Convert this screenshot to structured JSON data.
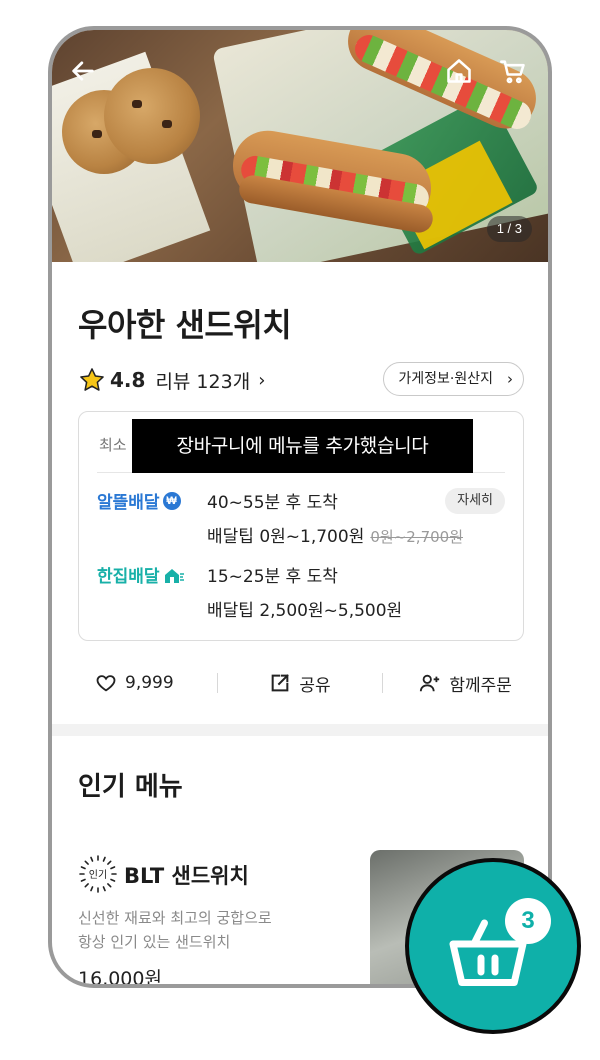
{
  "hero": {
    "image_counter": "1 / 3",
    "icons": {
      "back": "back-arrow-icon",
      "home": "home-icon",
      "cart": "cart-icon"
    }
  },
  "store": {
    "name": "우아한 샌드위치",
    "rating": "4.8",
    "review_text": "리뷰 123개",
    "info_button": "가게정보·원산지"
  },
  "delivery": {
    "min_order_label": "최소",
    "options": [
      {
        "label": "알뜰배달",
        "time": "40~55분 후 도착",
        "tip": "배달팁 0원~1,700원",
        "original_tip": "0원~2,700원",
        "detail_button": "자세히"
      },
      {
        "label": "한집배달",
        "time": "15~25분 후 도착",
        "tip": "배달팁 2,500원~5,500원"
      }
    ]
  },
  "toast": "장바구니에 메뉴를 추가했습니다",
  "actions": {
    "like_count": "9,999",
    "share_label": "공유",
    "group_order_label": "함께주문"
  },
  "section": {
    "title": "인기 메뉴"
  },
  "menu_items": [
    {
      "badge": "인기",
      "name": "BLT 샌드위치",
      "desc_line1": "신선한 재료와 최고의 궁합으로",
      "desc_line2": "항상 인기 있는 샌드위치",
      "price": "16,000원"
    }
  ],
  "cart": {
    "count": "3"
  },
  "colors": {
    "accent_teal": "#0fb0a9",
    "thrifty_blue": "#2a78d4",
    "single_teal": "#18b0a8"
  }
}
